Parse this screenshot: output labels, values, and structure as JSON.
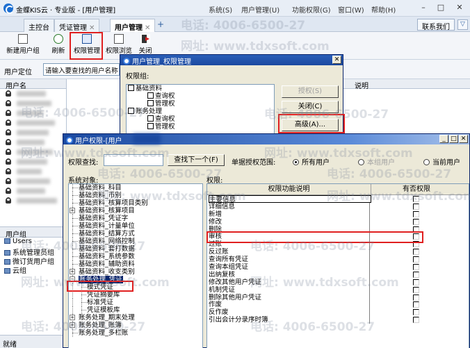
{
  "window": {
    "title": "金蝶KIS云 · 专业版 - [用户管理]",
    "menu": [
      "系统(S)",
      "用户管理(U)",
      "功能权限(G)",
      "窗口(W)",
      "帮助(H)"
    ],
    "controls": {
      "minimize": "–",
      "restore": "□",
      "close": "✕"
    }
  },
  "tabs": [
    {
      "label": "主控台",
      "closable": false
    },
    {
      "label": "凭证管理",
      "closable": true
    },
    {
      "label": "用户管理",
      "closable": true
    }
  ],
  "tab_add": "+",
  "tab_close_glyph": "✕",
  "contact_button": "联系我们",
  "collapse_glyph": "▽",
  "toolbar": {
    "new_group": "新建用户组",
    "refresh": "刷新",
    "perm_manage": "权限管理",
    "perm_browse": "权限浏览",
    "exit": "关闭"
  },
  "locate": {
    "label": "用户定位",
    "value": "请输入要查找的用户名称"
  },
  "user_list": {
    "header": "用户名",
    "right_header": "说明",
    "row_count": 12
  },
  "group_panel": {
    "header": "用户组",
    "items": [
      "Users",
      "系统管理员组",
      "微订货用户组",
      "云组"
    ]
  },
  "status": "就绪",
  "dialog1": {
    "title": "用户管理_权限管理",
    "close_glyph": "✕",
    "perm_group_label": "权限组:",
    "tree": [
      {
        "text": "基础资料",
        "level": 0
      },
      {
        "text": "查询权",
        "level": 2
      },
      {
        "text": "管理权",
        "level": 2
      },
      {
        "text": "账务处理",
        "level": 0
      },
      {
        "text": "查询权",
        "level": 2
      },
      {
        "text": "管理权",
        "level": 2
      }
    ],
    "buttons": {
      "authorize": "授权(S)",
      "close": "关闭(C)",
      "advanced": "高级(A)..."
    }
  },
  "dialog2": {
    "title": "用户权限-[用户",
    "title_buttons": {
      "minimize": "_",
      "maximize": "□",
      "close": "✕"
    },
    "search_label": "权限查找:",
    "search_value": "",
    "find_next": "查找下一个(F)",
    "scope_label": "单据授权范围:",
    "scope_options": [
      {
        "label": "所有用户",
        "selected": true,
        "enabled": true
      },
      {
        "label": "本组用户",
        "selected": false,
        "enabled": false
      },
      {
        "label": "当前用户",
        "selected": false,
        "enabled": true
      }
    ],
    "sys_obj_label": "系统对象:",
    "perm_label": "权限:",
    "tree": [
      {
        "text": "基础资料_科目",
        "type": "leaf"
      },
      {
        "text": "基础资料_币别",
        "type": "leaf"
      },
      {
        "text": "基础资料_核算项目类别",
        "type": "leaf"
      },
      {
        "text": "基础资料_核算项目",
        "type": "plus"
      },
      {
        "text": "基础资料_凭证字",
        "type": "leaf"
      },
      {
        "text": "基础资料_计量单位",
        "type": "leaf"
      },
      {
        "text": "基础资料_结算方式",
        "type": "leaf"
      },
      {
        "text": "基础资料_网络控制",
        "type": "leaf"
      },
      {
        "text": "基础资料_套打数据",
        "type": "leaf"
      },
      {
        "text": "基础资料_系统参数",
        "type": "leaf"
      },
      {
        "text": "基础资料_辅助资料",
        "type": "leaf"
      },
      {
        "text": "基础资料_收支类别",
        "type": "plus"
      },
      {
        "text": "账务处理_凭证",
        "type": "minus",
        "selected": true
      },
      {
        "text": "模式凭证",
        "type": "child"
      },
      {
        "text": "凭证摘要库",
        "type": "child"
      },
      {
        "text": "标准凭证",
        "type": "child"
      },
      {
        "text": "凭证模板库",
        "type": "child"
      },
      {
        "text": "账务处理_期末处理",
        "type": "plus"
      },
      {
        "text": "账务处理_账簿",
        "type": "plus"
      },
      {
        "text": "账务处理_多栏账",
        "type": "leaf"
      }
    ],
    "table_headers": {
      "name": "权限功能说明",
      "check": "有否权限"
    },
    "perms": [
      "主要信息",
      "详细信息",
      "新增",
      "修改",
      "删除",
      "审核",
      "过账",
      "反过账",
      "查询所有凭证",
      "查询本组凭证",
      "出纳复核",
      "修改其他用户凭证",
      "机制凭证",
      "删除其他用户凭证",
      "作废",
      "反作废",
      "引出会计分录序时簿"
    ]
  },
  "watermark": {
    "phone": "电话: 4006-6500-27",
    "site": "网址: www.tdxsoft.com"
  },
  "accent_color": "#e02020"
}
